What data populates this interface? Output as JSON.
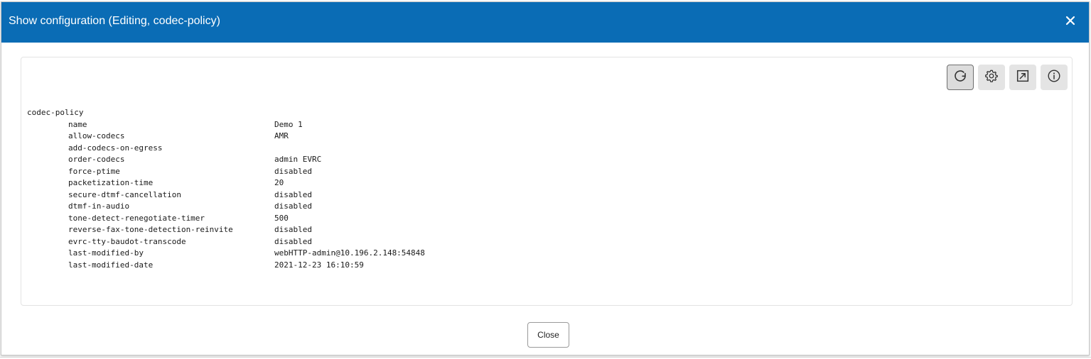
{
  "dialog": {
    "title": "Show configuration  (Editing, codec-policy)",
    "close_icon": "close-icon",
    "close_button_label": "Close"
  },
  "toolbar": {
    "buttons": [
      {
        "icon": "refresh-icon"
      },
      {
        "icon": "gear-icon"
      },
      {
        "icon": "expand-icon"
      },
      {
        "icon": "info-icon"
      }
    ]
  },
  "config": {
    "root": "codec-policy",
    "rows": [
      {
        "key": "name",
        "value": "Demo 1"
      },
      {
        "key": "allow-codecs",
        "value": "AMR"
      },
      {
        "key": "add-codecs-on-egress",
        "value": ""
      },
      {
        "key": "order-codecs",
        "value": "admin EVRC"
      },
      {
        "key": "force-ptime",
        "value": "disabled"
      },
      {
        "key": "packetization-time",
        "value": "20"
      },
      {
        "key": "secure-dtmf-cancellation",
        "value": "disabled"
      },
      {
        "key": "dtmf-in-audio",
        "value": "disabled"
      },
      {
        "key": "tone-detect-renegotiate-timer",
        "value": "500"
      },
      {
        "key": "reverse-fax-tone-detection-reinvite",
        "value": "disabled"
      },
      {
        "key": "evrc-tty-baudot-transcode",
        "value": "disabled"
      },
      {
        "key": "last-modified-by",
        "value": "webHTTP-admin@10.196.2.148:54848"
      },
      {
        "key": "last-modified-date",
        "value": "2021-12-23 16:10:59"
      }
    ]
  },
  "colors": {
    "header_bg": "#0a6cb5",
    "header_text": "#ffffff",
    "tool_button_bg": "#e4e4e4"
  }
}
